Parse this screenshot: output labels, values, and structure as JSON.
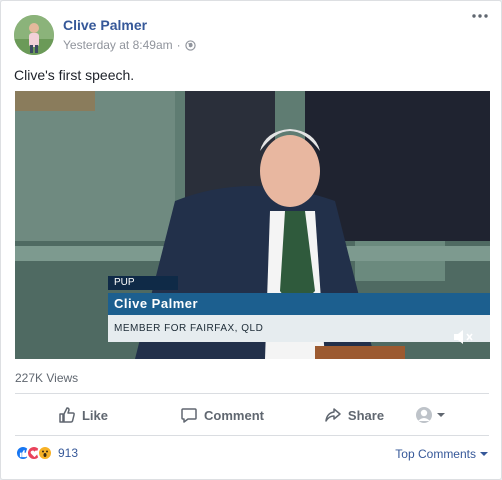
{
  "post": {
    "author": "Clive Palmer",
    "timestamp": "Yesterday at 8:49am",
    "separator": "·",
    "privacy_icon": "globe-icon",
    "more_icon": "ellipsis-icon",
    "text": "Clive's first speech."
  },
  "video": {
    "party_tag": "PUP",
    "name_caption": "Clive Palmer",
    "title_caption": "MEMBER FOR FAIRFAX, QLD",
    "mute_icon": "speaker-muted-icon",
    "caption_color": "#1c5f8f"
  },
  "stats": {
    "views": "227K Views",
    "reaction_count": "913",
    "reaction_icons": [
      "like-icon",
      "love-icon",
      "wow-icon"
    ]
  },
  "actions": {
    "like": "Like",
    "comment": "Comment",
    "share": "Share",
    "viewer_icon": "profile-selector-icon"
  },
  "comments": {
    "sort_label": "Top Comments"
  },
  "colors": {
    "link": "#365899",
    "muted": "#90949c",
    "action": "#606770",
    "like_blue": "#1877f2",
    "love_red": "#e9435c",
    "wow_yellow": "#f7b125"
  }
}
